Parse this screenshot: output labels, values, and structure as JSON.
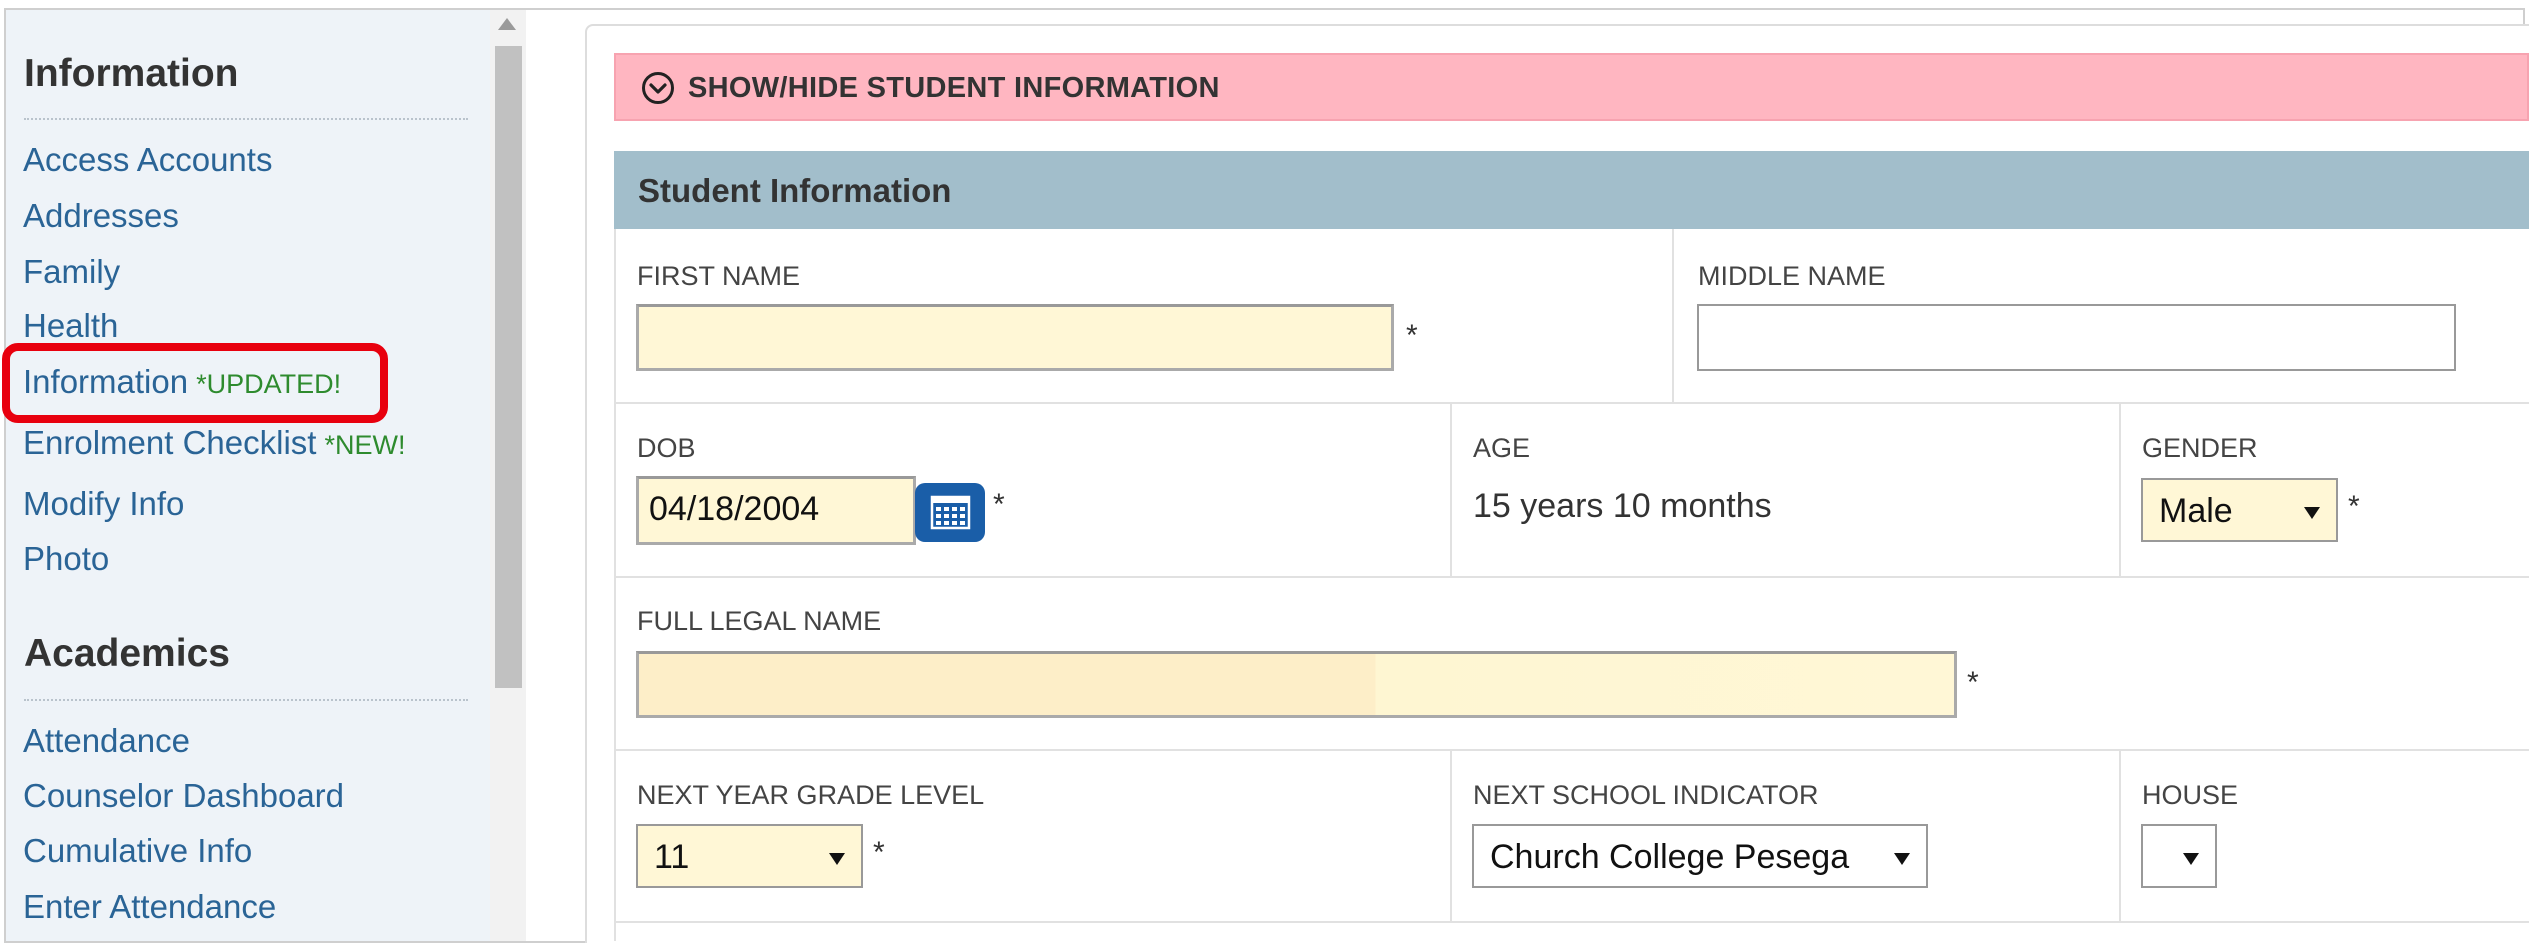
{
  "sidebar": {
    "sections": [
      {
        "heading": "Information",
        "links": [
          {
            "label": "Access Accounts"
          },
          {
            "label": "Addresses"
          },
          {
            "label": "Family"
          },
          {
            "label": "Health"
          },
          {
            "label": "Information",
            "tag": "*UPDATED!"
          },
          {
            "label": "Enrolment Checklist",
            "tag": "*NEW!"
          },
          {
            "label": "Modify Info"
          },
          {
            "label": "Photo"
          }
        ]
      },
      {
        "heading": "Academics",
        "links": [
          {
            "label": "Attendance"
          },
          {
            "label": "Counselor Dashboard"
          },
          {
            "label": "Cumulative Info"
          },
          {
            "label": "Enter Attendance"
          }
        ]
      }
    ]
  },
  "toggle": {
    "label": "SHOW/HIDE STUDENT INFORMATION"
  },
  "section": {
    "title": "Student Information"
  },
  "fields": {
    "first_name": {
      "label": "FIRST NAME",
      "value": "",
      "required": "*"
    },
    "middle_name": {
      "label": "MIDDLE NAME",
      "value": ""
    },
    "dob": {
      "label": "DOB",
      "value": "04/18/2004",
      "required": "*"
    },
    "age": {
      "label": "AGE",
      "value": "15 years 10 months"
    },
    "gender": {
      "label": "GENDER",
      "value": "Male",
      "required": "*"
    },
    "full_legal_name": {
      "label": "FULL LEGAL NAME",
      "value": "",
      "required": "*"
    },
    "next_year_grade": {
      "label": "NEXT YEAR GRADE LEVEL",
      "value": "11",
      "required": "*"
    },
    "next_school": {
      "label": "NEXT SCHOOL INDICATOR",
      "value": "Church College Pesega"
    },
    "house": {
      "label": "HOUSE",
      "value": ""
    }
  },
  "colors": {
    "link": "#2a6496",
    "tag": "#2e8b2e",
    "highlight": "#e8000e",
    "toggle_bg": "#ffb6c1",
    "section_bg": "#a2becb",
    "required_bg": "#fff7d6"
  }
}
